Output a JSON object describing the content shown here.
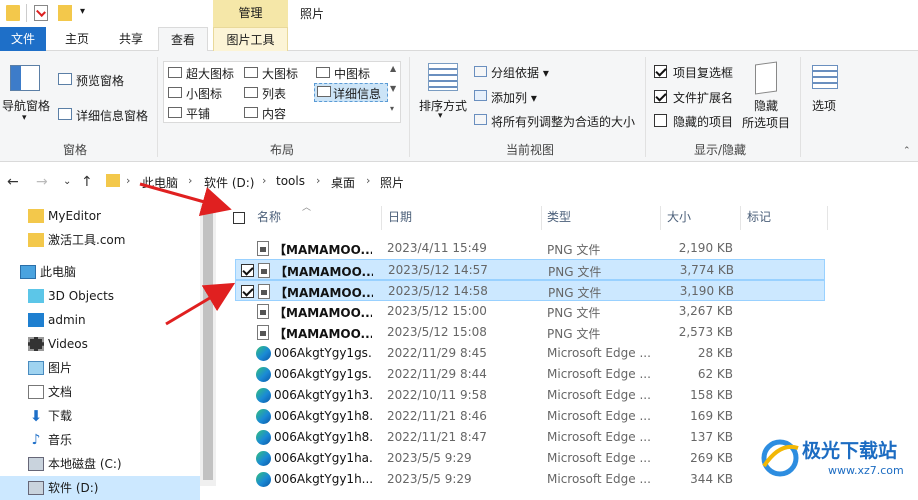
{
  "titlebar": {
    "context_group": "管理",
    "title": "照片"
  },
  "tabs": [
    {
      "label": "文件"
    },
    {
      "label": "主页"
    },
    {
      "label": "共享"
    },
    {
      "label": "查看"
    },
    {
      "label": "图片工具"
    }
  ],
  "ribbon": {
    "panes": {
      "nav_pane": "导航窗格",
      "preview_pane": "预览窗格",
      "details_pane": "详细信息窗格",
      "group_label": "窗格"
    },
    "layout": {
      "items": [
        "超大图标",
        "大图标",
        "中图标",
        "小图标",
        "列表",
        "详细信息",
        "平铺",
        "内容"
      ],
      "group_label": "布局"
    },
    "current_view": {
      "sort_by": "排序方式",
      "group_by": "分组依据",
      "add_column": "添加列",
      "fit_columns": "将所有列调整为合适的大小",
      "group_label": "当前视图"
    },
    "show_hide": {
      "item_checkboxes": "项目复选框",
      "file_extensions": "文件扩展名",
      "hidden_items": "隐藏的项目",
      "hide_selected_1": "隐藏",
      "hide_selected_2": "所选项目",
      "group_label": "显示/隐藏",
      "item_checkboxes_checked": true,
      "file_extensions_checked": true,
      "hidden_items_checked": false
    },
    "options": "选项"
  },
  "address": {
    "crumbs": [
      "此电脑",
      "软件 (D:)",
      "tools",
      "桌面",
      "照片"
    ]
  },
  "nav": {
    "items": [
      {
        "label": "MyEditor",
        "icon": "folder-icon"
      },
      {
        "label": "激活工具.com",
        "icon": "folder-icon"
      },
      {
        "label": "此电脑",
        "icon": "computer-icon"
      },
      {
        "label": "3D Objects",
        "icon": "3d-objects-icon"
      },
      {
        "label": "admin",
        "icon": "desktop-icon"
      },
      {
        "label": "Videos",
        "icon": "videos-icon"
      },
      {
        "label": "图片",
        "icon": "pictures-icon"
      },
      {
        "label": "文档",
        "icon": "documents-icon"
      },
      {
        "label": "下载",
        "icon": "download-icon"
      },
      {
        "label": "音乐",
        "icon": "music-icon"
      },
      {
        "label": "本地磁盘 (C:)",
        "icon": "drive-icon"
      },
      {
        "label": "软件 (D:)",
        "icon": "drive-icon"
      }
    ]
  },
  "columns": {
    "name": "名称",
    "date": "日期",
    "type": "类型",
    "size": "大小",
    "tags": "标记"
  },
  "files": [
    {
      "name": "【MAMAMOO...",
      "date": "2023/4/11 15:49",
      "type": "PNG 文件",
      "size": "2,190 KB",
      "checked": false,
      "selected": false
    },
    {
      "name": "【MAMAMOO...",
      "date": "2023/5/12 14:57",
      "type": "PNG 文件",
      "size": "3,774 KB",
      "checked": true,
      "selected": true
    },
    {
      "name": "【MAMAMOO...",
      "date": "2023/5/12 14:58",
      "type": "PNG 文件",
      "size": "3,190 KB",
      "checked": true,
      "selected": true
    },
    {
      "name": "【MAMAMOO...",
      "date": "2023/5/12 15:00",
      "type": "PNG 文件",
      "size": "3,267 KB",
      "checked": false,
      "selected": false
    },
    {
      "name": "【MAMAMOO...",
      "date": "2023/5/12 15:08",
      "type": "PNG 文件",
      "size": "2,573 KB",
      "checked": false,
      "selected": false
    },
    {
      "name": "006AkgtYgy1gs...",
      "date": "2022/11/29 8:45",
      "type": "Microsoft Edge ...",
      "size": "28 KB",
      "checked": false,
      "selected": false
    },
    {
      "name": "006AkgtYgy1gs...",
      "date": "2022/11/29 8:44",
      "type": "Microsoft Edge ...",
      "size": "62 KB",
      "checked": false,
      "selected": false
    },
    {
      "name": "006AkgtYgy1h3...",
      "date": "2022/10/11 9:58",
      "type": "Microsoft Edge ...",
      "size": "158 KB",
      "checked": false,
      "selected": false
    },
    {
      "name": "006AkgtYgy1h8...",
      "date": "2022/11/21 8:46",
      "type": "Microsoft Edge ...",
      "size": "169 KB",
      "checked": false,
      "selected": false
    },
    {
      "name": "006AkgtYgy1h8...",
      "date": "2022/11/21 8:47",
      "type": "Microsoft Edge ...",
      "size": "137 KB",
      "checked": false,
      "selected": false
    },
    {
      "name": "006AkgtYgy1ha...",
      "date": "2023/5/5 9:29",
      "type": "Microsoft Edge ...",
      "size": "269 KB",
      "checked": false,
      "selected": false
    },
    {
      "name": "006AkgtYgy1h...",
      "date": "2023/5/5 9:29",
      "type": "Microsoft Edge ...",
      "size": "344 KB",
      "checked": false,
      "selected": false
    }
  ],
  "watermark": {
    "brand": "极光下载站",
    "url": "www.xz7.com"
  },
  "colors": {
    "file_tab": "#1e6fc8",
    "selection": "#cce8ff",
    "arrow": "#e02020",
    "context_tab": "#f5e7a8"
  }
}
